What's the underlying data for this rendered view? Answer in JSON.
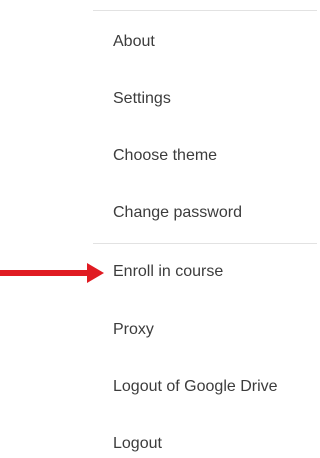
{
  "menu": {
    "items": [
      {
        "label": "About"
      },
      {
        "label": "Settings"
      },
      {
        "label": "Choose theme"
      },
      {
        "label": "Change password"
      },
      {
        "label": "Enroll in course"
      },
      {
        "label": "Proxy"
      },
      {
        "label": "Logout of Google Drive"
      },
      {
        "label": "Logout"
      }
    ]
  },
  "annotation": {
    "icon": "arrow-right-icon",
    "color": "#e01b22",
    "points_to": "Enroll in course"
  }
}
